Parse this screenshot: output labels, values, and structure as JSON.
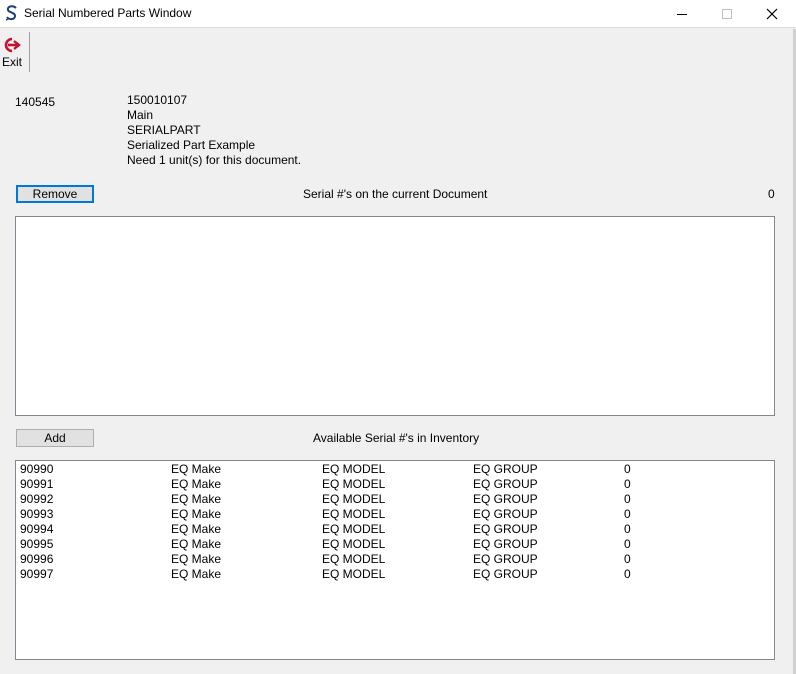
{
  "window": {
    "title": "Serial Numbered Parts Window"
  },
  "toolbar": {
    "exit_label": "Exit"
  },
  "part": {
    "id": "140545",
    "number": "150010107",
    "location": "Main",
    "code": "SERIALPART",
    "description": "Serialized Part Example",
    "need_text": "Need 1 unit(s) for this document."
  },
  "current_doc": {
    "button_label": "Remove",
    "header": "Serial #'s on the current Document",
    "count": "0",
    "items": []
  },
  "inventory": {
    "button_label": "Add",
    "header": "Available Serial #'s in Inventory",
    "rows": [
      {
        "serial": "90990",
        "make": "EQ Make",
        "model": "EQ MODEL",
        "group": "EQ GROUP",
        "qty": "0"
      },
      {
        "serial": "90991",
        "make": "EQ Make",
        "model": "EQ MODEL",
        "group": "EQ GROUP",
        "qty": "0"
      },
      {
        "serial": "90992",
        "make": "EQ Make",
        "model": "EQ MODEL",
        "group": "EQ GROUP",
        "qty": "0"
      },
      {
        "serial": "90993",
        "make": "EQ Make",
        "model": "EQ MODEL",
        "group": "EQ GROUP",
        "qty": "0"
      },
      {
        "serial": "90994",
        "make": "EQ Make",
        "model": "EQ MODEL",
        "group": "EQ GROUP",
        "qty": "0"
      },
      {
        "serial": "90995",
        "make": "EQ Make",
        "model": "EQ MODEL",
        "group": "EQ GROUP",
        "qty": "0"
      },
      {
        "serial": "90996",
        "make": "EQ Make",
        "model": "EQ MODEL",
        "group": "EQ GROUP",
        "qty": "0"
      },
      {
        "serial": "90997",
        "make": "EQ Make",
        "model": "EQ MODEL",
        "group": "EQ GROUP",
        "qty": "0"
      }
    ]
  },
  "icons": {
    "app": "app-logo-icon",
    "exit": "exit-icon",
    "minimize": "minimize-icon",
    "maximize": "maximize-icon",
    "close": "close-icon"
  },
  "colors": {
    "exit_icon": "#c8102e",
    "focus_border": "#0078d7",
    "window_bg": "#f0f0f0"
  }
}
